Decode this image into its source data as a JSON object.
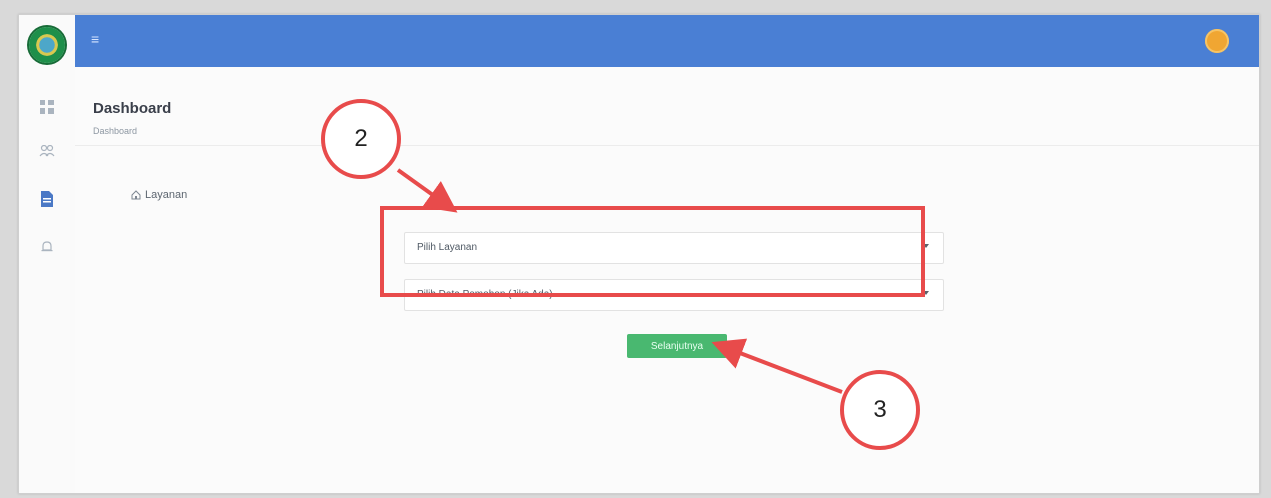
{
  "header": {
    "page_title": "Dashboard",
    "breadcrumb": "Dashboard"
  },
  "sidebar": {
    "items": [
      {
        "icon": "dashboard-icon"
      },
      {
        "icon": "users-icon"
      },
      {
        "icon": "document-icon"
      },
      {
        "icon": "bell-icon"
      }
    ]
  },
  "main": {
    "service_tab": "Layanan",
    "service_select_placeholder": "Pilih Layanan",
    "applicant_select_placeholder": "Pilih Data Pemohon (Jika Ada)",
    "next_button": "Selanjutnya"
  },
  "annotations": {
    "callout_2": "2",
    "callout_3": "3"
  },
  "colors": {
    "topbar": "#4a7fd4",
    "accent": "#49b870",
    "annotation": "#e84b4b"
  }
}
